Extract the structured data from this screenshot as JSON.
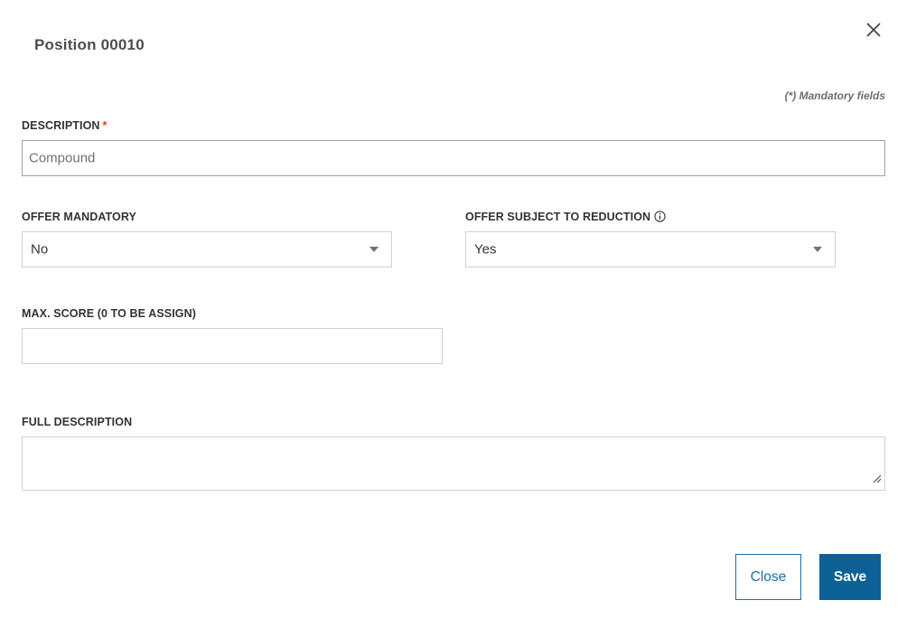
{
  "dialog": {
    "title": "Position 00010",
    "close_icon": "close-x-icon",
    "mandatory_note": "(*) Mandatory fields"
  },
  "fields": {
    "description": {
      "label": "DESCRIPTION",
      "required_mark": "*",
      "placeholder": "Compound",
      "value": ""
    },
    "offer_mandatory": {
      "label": "OFFER MANDATORY",
      "selected": "No"
    },
    "offer_subject_to_reduction": {
      "label": "OFFER SUBJECT TO REDUCTION",
      "info_icon": "info-circle-icon",
      "selected": "Yes"
    },
    "max_score": {
      "label": "MAX. SCORE (0 TO BE ASSIGN)",
      "value": ""
    },
    "full_description": {
      "label": "FULL DESCRIPTION",
      "value": ""
    }
  },
  "buttons": {
    "close_label": "Close",
    "save_label": "Save"
  },
  "colors": {
    "primary": "#0d6196",
    "required": "#d9382b",
    "border": "#cfd3d6"
  }
}
